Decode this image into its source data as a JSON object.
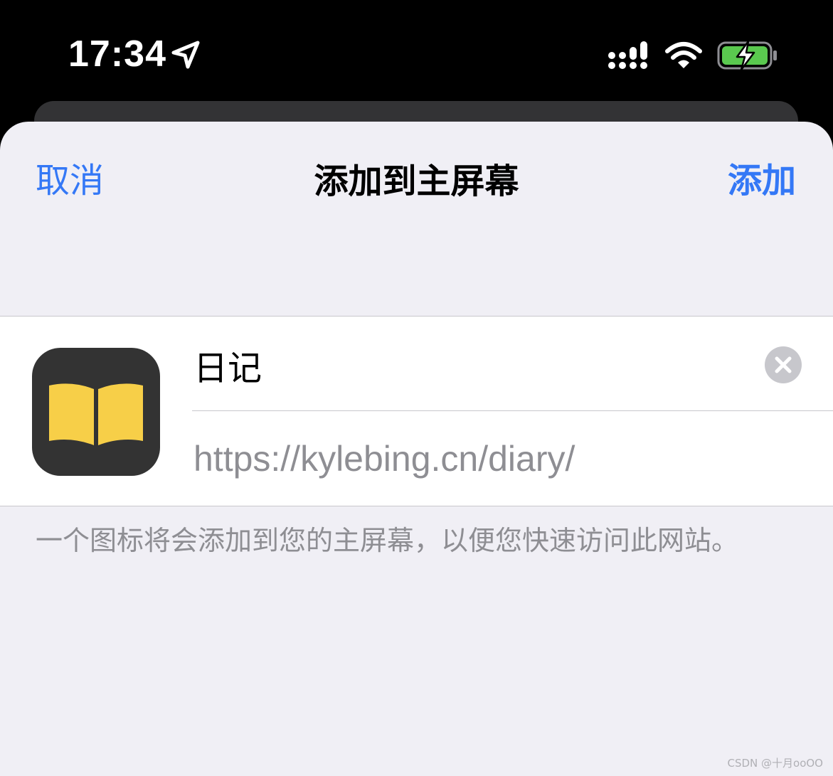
{
  "status_bar": {
    "time": "17:34",
    "icons": [
      "location-arrow-icon",
      "cellular-signal-icon",
      "wifi-icon",
      "battery-charging-icon"
    ],
    "battery_color": "#5ac94f"
  },
  "nav": {
    "cancel_label": "取消",
    "title": "添加到主屏幕",
    "add_label": "添加",
    "accent_color": "#3478f6"
  },
  "form": {
    "app_icon": "book-icon",
    "name_value": "日记",
    "url": "https://kylebing.cn/diary/",
    "clear_icon": "clear-x-icon"
  },
  "footer_note": "一个图标将会添加到您的主屏幕，以便您快速访问此网站。",
  "watermark": "CSDN @十月ooOO"
}
